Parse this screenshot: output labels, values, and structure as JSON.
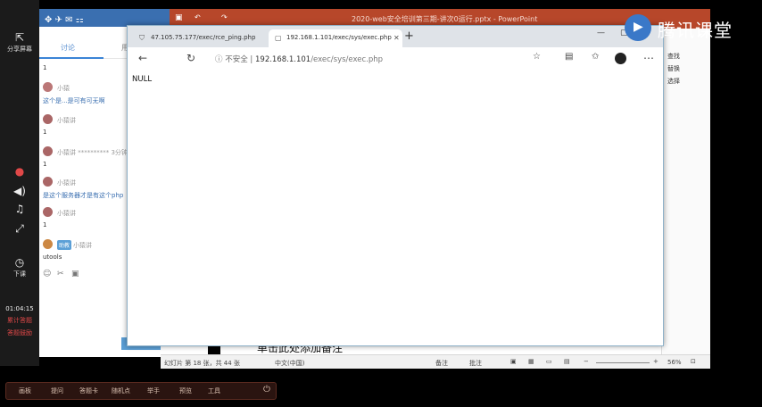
{
  "left_rail": {
    "share_label": "分享屏幕",
    "time": "01:04:15",
    "status_lines": [
      "累计答题",
      "答题鼓励"
    ],
    "class_label": "下课"
  },
  "chat": {
    "tabs": [
      "讨论",
      "用"
    ],
    "messages": [
      {
        "name": "",
        "text": "1"
      },
      {
        "name": "小猿",
        "text": "这个是...是可有可无啊"
      },
      {
        "name": "小猿讲",
        "text": "1"
      },
      {
        "name": "小猿讲 ********** 3分钟",
        "text": "1"
      },
      {
        "name": "小猿讲",
        "text": "是这个服务器才是有这个php"
      },
      {
        "name": "小猿讲",
        "text": "1"
      }
    ],
    "tutor_badge": "助教",
    "tutor_name": "小猿讲",
    "tutor_text": "utools"
  },
  "ppt": {
    "title": "2020-web安全培训第三期-讲次0运行.pptx - PowerPoint",
    "notes_placeholder": "单击此处添加备注",
    "status_slide": "幻灯片 第 18 张，共 44 张",
    "status_lang": "中文(中国)",
    "status_notes": "备注",
    "status_comments": "批注",
    "status_zoom": "56%",
    "right_panel_items": [
      "查找",
      "替换",
      "选择"
    ]
  },
  "browser": {
    "tabs": [
      {
        "title": "47.105.75.177/exec/rce_ping.php",
        "active": false
      },
      {
        "title": "192.168.1.101/exec/sys/exec.php",
        "active": true
      }
    ],
    "address": {
      "security_label": "不安全",
      "host": "192.168.1.101",
      "path": "/exec/sys/exec.php"
    },
    "content_text": "NULL"
  },
  "taskbar": {
    "items": [
      "画板",
      "提问",
      "答题卡",
      "随机点",
      "举手",
      "预览",
      "工具"
    ]
  },
  "watermark": {
    "text": "腾讯课堂"
  },
  "colors": {
    "ppt_brand": "#b7472a",
    "chat_header": "#3a6fb0",
    "browser_border": "#8fb2c9"
  }
}
